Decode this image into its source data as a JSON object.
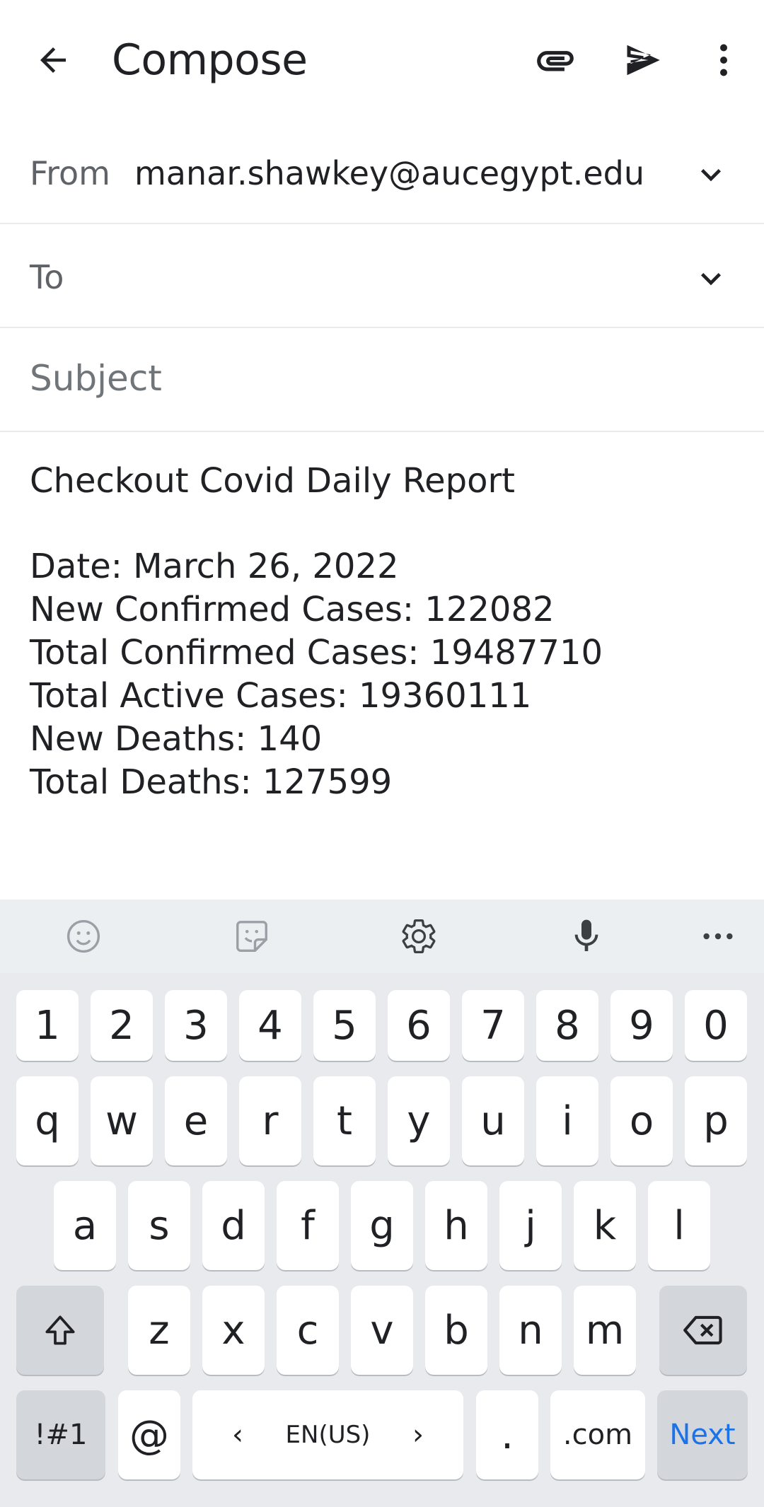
{
  "app": {
    "title": "Compose"
  },
  "fields": {
    "from_label": "From",
    "from_value": "manar.shawkey@aucegypt.edu",
    "to_label": "To",
    "subject_placeholder": "Subject"
  },
  "body": {
    "line1": "Checkout Covid Daily Report",
    "line2": "Date: March 26, 2022",
    "line3": "New Confirmed Cases: 122082",
    "line4": "Total Confirmed Cases: 19487710",
    "line5": "Total Active Cases: 19360111",
    "line6": "New Deaths: 140",
    "line7": "Total Deaths: 127599"
  },
  "keyboard": {
    "toolbar_icons": [
      "emoji-icon",
      "sticker-icon",
      "settings-icon",
      "mic-icon",
      "more-horizontal-icon"
    ],
    "row_numbers": [
      "1",
      "2",
      "3",
      "4",
      "5",
      "6",
      "7",
      "8",
      "9",
      "0"
    ],
    "row_q": [
      "q",
      "w",
      "e",
      "r",
      "t",
      "y",
      "u",
      "i",
      "o",
      "p"
    ],
    "row_a": [
      "a",
      "s",
      "d",
      "f",
      "g",
      "h",
      "j",
      "k",
      "l"
    ],
    "row_z": [
      "z",
      "x",
      "c",
      "v",
      "b",
      "n",
      "m"
    ],
    "symbols_label": "!#1",
    "at_label": "@",
    "language_label": "EN(US)",
    "period_label": ".",
    "dotcom_label": ".com",
    "next_label": "Next"
  },
  "colors": {
    "accent": "#1a73e8",
    "keyboard_bg": "#e8eaed"
  }
}
